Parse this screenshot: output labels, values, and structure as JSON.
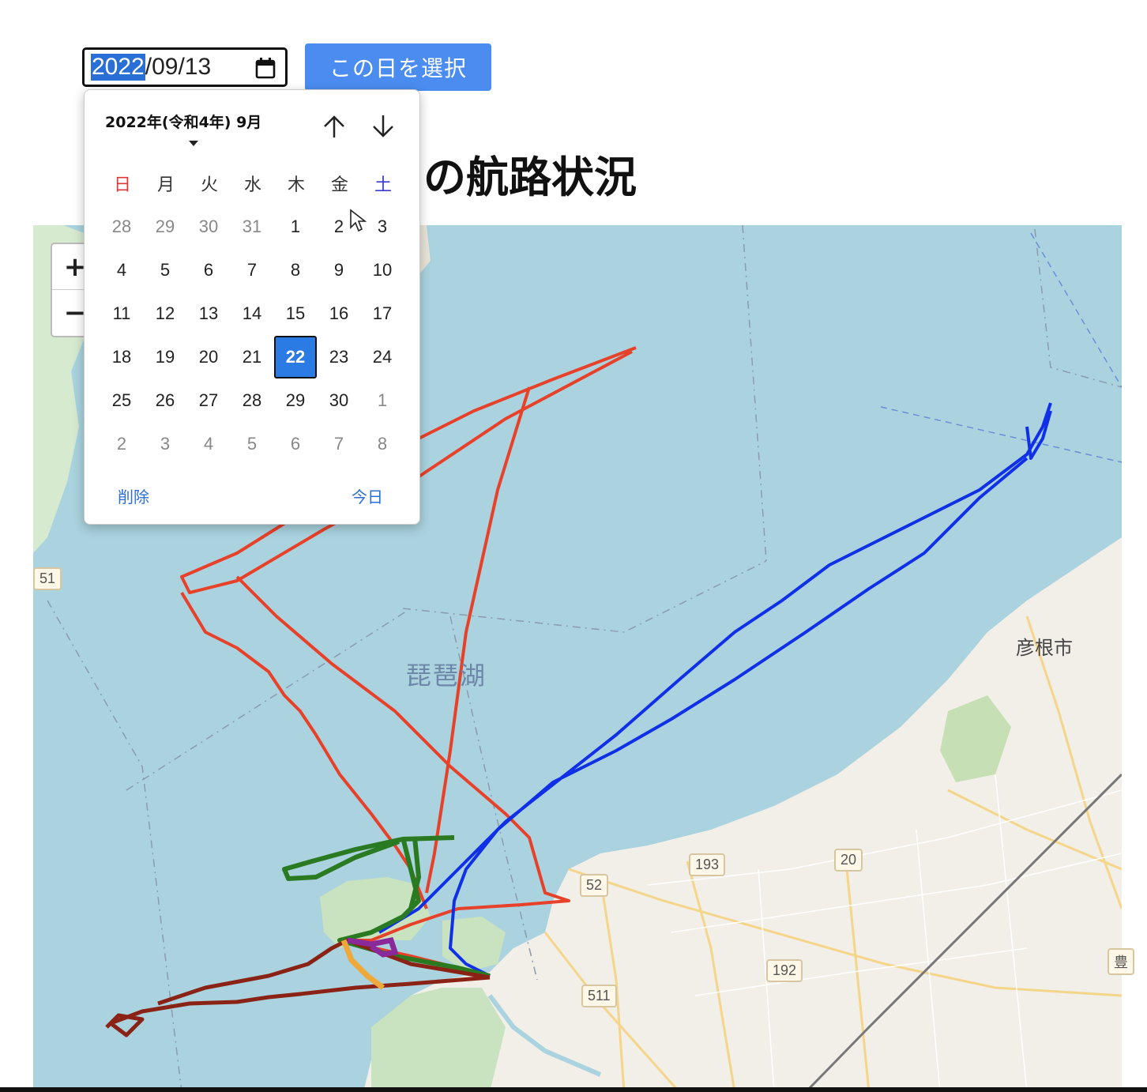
{
  "date_input": {
    "year": "2022",
    "rest": "/09/13",
    "calendar_icon": "calendar-icon"
  },
  "select_button": "この日を選択",
  "page_title": "の航路状況",
  "map": {
    "zoom_in": "+",
    "zoom_out": "−",
    "lake_label": "琵琶湖",
    "city_label": "彦根市",
    "road_shields": [
      "193",
      "20",
      "52",
      "192",
      "511"
    ],
    "edge_labels": [
      "51",
      "豊"
    ],
    "track_colors": {
      "red": "#e8412a",
      "blue": "#1030e8",
      "green": "#2a7a22",
      "dark_red": "#8a2316",
      "purple": "#8a2a9a",
      "orange": "#f0a83a"
    }
  },
  "calendar": {
    "month_label": "2022年(令和4年) 9月",
    "prev_icon": "arrow-up-icon",
    "next_icon": "arrow-down-icon",
    "weekdays": [
      "日",
      "月",
      "火",
      "水",
      "木",
      "金",
      "土"
    ],
    "weekday_colors": [
      "#d83a3a",
      "#333333",
      "#333333",
      "#333333",
      "#333333",
      "#333333",
      "#3a3ad8"
    ],
    "weeks": [
      [
        "28",
        "29",
        "30",
        "31",
        "1",
        "2",
        "3"
      ],
      [
        "4",
        "5",
        "6",
        "7",
        "8",
        "9",
        "10"
      ],
      [
        "11",
        "12",
        "13",
        "14",
        "15",
        "16",
        "17"
      ],
      [
        "18",
        "19",
        "20",
        "21",
        "22",
        "23",
        "24"
      ],
      [
        "25",
        "26",
        "27",
        "28",
        "29",
        "30",
        "1"
      ],
      [
        "2",
        "3",
        "4",
        "5",
        "6",
        "7",
        "8"
      ]
    ],
    "selected_day": "22",
    "clear_label": "削除",
    "today_label": "今日"
  }
}
